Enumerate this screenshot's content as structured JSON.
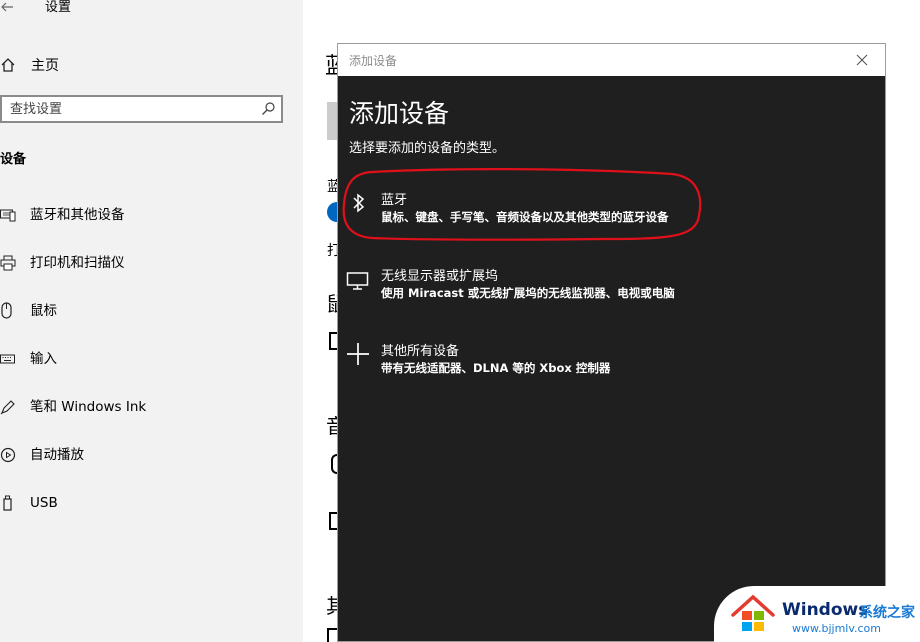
{
  "settings": {
    "window_title": "设置",
    "home_label": "主页",
    "search": {
      "placeholder": "查找设置"
    },
    "section_title": "设备",
    "nav_items": [
      {
        "label": "蓝牙和其他设备",
        "icon": "bluetooth-devices-icon"
      },
      {
        "label": "打印机和扫描仪",
        "icon": "printer-icon"
      },
      {
        "label": "鼠标",
        "icon": "mouse-icon"
      },
      {
        "label": "输入",
        "icon": "keyboard-icon"
      },
      {
        "label": "笔和 Windows Ink",
        "icon": "pen-icon"
      },
      {
        "label": "自动播放",
        "icon": "autoplay-icon"
      },
      {
        "label": "USB",
        "icon": "usb-icon"
      }
    ],
    "content_fragments": {
      "heading_char": "蓝",
      "bluetooth_char": "蓝",
      "print_char": "打",
      "mouse_char": "鼠",
      "audio_char": "音",
      "other_char": "其"
    }
  },
  "dialog": {
    "window_title": "添加设备",
    "heading": "添加设备",
    "subtitle": "选择要添加的设备的类型。",
    "options": [
      {
        "name": "蓝牙",
        "description": "鼠标、键盘、手写笔、音频设备以及其他类型的蓝牙设备",
        "icon": "bluetooth-icon"
      },
      {
        "name": "无线显示器或扩展坞",
        "description": "使用 Miracast 或无线扩展坞的无线监视器、电视或电脑",
        "icon": "monitor-icon"
      },
      {
        "name": "其他所有设备",
        "description": "带有无线适配器、DLNA 等的 Xbox 控制器",
        "icon": "plus-icon"
      }
    ],
    "highlight_color": "#e0101a"
  },
  "watermark": {
    "brand": "Windows",
    "brand_cn": "系统之家",
    "url": "www.bjjmlv.com"
  },
  "colors": {
    "accent": "#0067c0",
    "dialog_bg": "#1f1f1f",
    "sidebar_bg": "#f2f2f2"
  }
}
